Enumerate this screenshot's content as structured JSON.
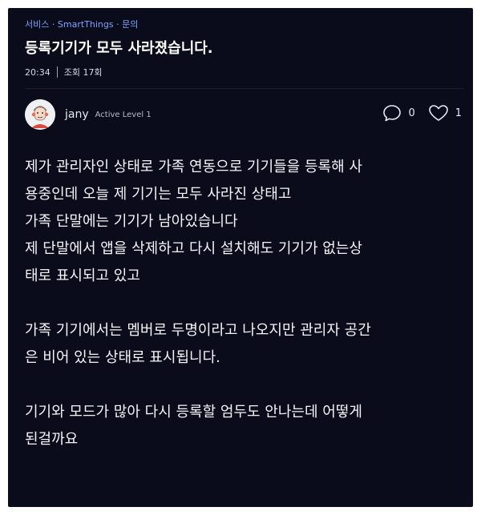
{
  "breadcrumb": {
    "items": [
      "서비스",
      "SmartThings",
      "문의"
    ],
    "separator": "·"
  },
  "post": {
    "title": "등록기기가 모두 사라졌습니다.",
    "time": "20:34",
    "views_label": "조회 17회"
  },
  "author": {
    "name": "jany",
    "level": "Active Level 1",
    "avatar_icon": "avatar-icon"
  },
  "stats": {
    "comments": "0",
    "likes": "1",
    "comment_icon": "comment-bubble-icon",
    "like_icon": "heart-icon"
  },
  "content": {
    "paragraph1": [
      "제가 관리자인 상태로 가족 연동으로 기기들을 등록해 사",
      "용중인데 오늘 제 기기는 모두 사라진 상태고",
      "가족 단말에는 기기가 남아있습니다",
      "제 단말에서 앱을 삭제하고 다시 설치해도 기기가 없는상",
      "태로 표시되고 있고"
    ],
    "paragraph2": [
      "가족 기기에서는 멤버로 두명이라고 나오지만 관리자 공간",
      "은 비어 있는 상태로 표시됩니다."
    ],
    "paragraph3": [
      "기기와 모드가 많아 다시 등록할 엄두도 안나는데 어떻게",
      "된걸까요"
    ]
  },
  "colors": {
    "background": "#0b0c1b",
    "link": "#7fa3ff",
    "text": "#f4f4f8"
  }
}
